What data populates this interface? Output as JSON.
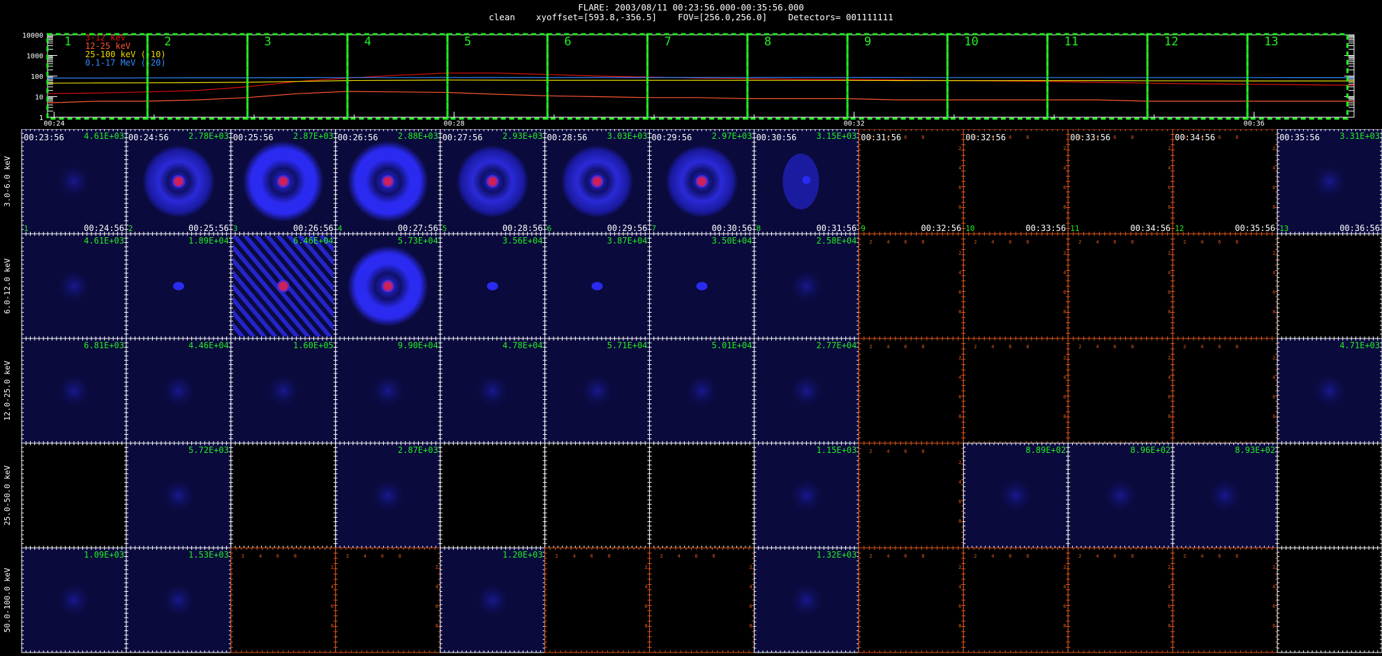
{
  "header": {
    "line1": "FLARE: 2003/08/11 00:23:56.000-00:35:56.000",
    "line2": "clean    xyoffset=[593.8,-356.5]    FOV=[256.0,256.0]    Detectors= 001111111"
  },
  "colors": {
    "background": "#000000",
    "frame": "#ffffff",
    "green_label": "#22ee22",
    "empty_axis": "#e0581c",
    "image_bg": "#0a0a3c",
    "image_blue": "#2a2af0",
    "core_red": "#d0205a",
    "series_3_12": "#e01010",
    "series_12_25": "#ff5533",
    "series_25_100": "#eedd00",
    "series_0p1_17": "#3388ff"
  },
  "chart_data": [
    {
      "type": "line",
      "yscale": "log",
      "ylim": [
        1,
        10000
      ],
      "ytick_labels": [
        "10000",
        "1000",
        "100",
        "10",
        "1"
      ],
      "xlim": [
        "00:23:56",
        "00:37:00"
      ],
      "xtick_labels": [
        "00:24",
        "00:28",
        "00:32",
        "00:36"
      ],
      "x_minutes": [
        0,
        0.5,
        1,
        1.5,
        2,
        2.5,
        3,
        3.5,
        4,
        4.5,
        5,
        5.5,
        6,
        6.5,
        7,
        7.5,
        8,
        8.5,
        9,
        9.5,
        10,
        10.5,
        11,
        11.5,
        12,
        12.5,
        13,
        13.5,
        14,
        14.2,
        14.4,
        14.6,
        14.8,
        15
      ],
      "series": [
        {
          "name": "3-12 keV",
          "color": "#e01010",
          "values": [
            14,
            15,
            17,
            20,
            30,
            55,
            80,
            110,
            140,
            140,
            120,
            100,
            90,
            80,
            75,
            70,
            68,
            65,
            60,
            58,
            55,
            50,
            45,
            42,
            40,
            38,
            36,
            33,
            30,
            22,
            14,
            18,
            24,
            25
          ]
        },
        {
          "name": "12-25 keV",
          "color": "#ff5533",
          "values": [
            5,
            6,
            6,
            7,
            9,
            14,
            18,
            17,
            16,
            13,
            11,
            10,
            9,
            9,
            8,
            8,
            8,
            7,
            7,
            7,
            7,
            7,
            6,
            6,
            6,
            6,
            6,
            6,
            6,
            5,
            4,
            5,
            6,
            6
          ]
        },
        {
          "name": "25-100 keV (-10)",
          "color": "#eedd00",
          "values": [
            45,
            46,
            47,
            48,
            50,
            55,
            60,
            62,
            64,
            63,
            62,
            62,
            62,
            62,
            62,
            61,
            61,
            60,
            60,
            60,
            60,
            60,
            59,
            59,
            58,
            58,
            58,
            58,
            57,
            30,
            2,
            20,
            55,
            57
          ]
        },
        {
          "name": "0.1-17 MeV (-20)",
          "color": "#3388ff",
          "values": [
            80,
            80,
            81,
            82,
            82,
            83,
            84,
            84,
            85,
            85,
            85,
            85,
            85,
            85,
            85,
            85,
            85,
            85,
            84,
            84,
            84,
            84,
            84,
            84,
            84,
            83,
            83,
            83,
            82,
            40,
            1.5,
            30,
            80,
            82
          ]
        }
      ],
      "intervals": [
        {
          "label": "1",
          "start": "00:23:56",
          "end": "00:24:56"
        },
        {
          "label": "2",
          "start": "00:24:56",
          "end": "00:25:56"
        },
        {
          "label": "3",
          "start": "00:25:56",
          "end": "00:26:56"
        },
        {
          "label": "4",
          "start": "00:26:56",
          "end": "00:27:56"
        },
        {
          "label": "5",
          "start": "00:27:56",
          "end": "00:28:56"
        },
        {
          "label": "6",
          "start": "00:28:56",
          "end": "00:29:56"
        },
        {
          "label": "7",
          "start": "00:29:56",
          "end": "00:30:56"
        },
        {
          "label": "8",
          "start": "00:30:56",
          "end": "00:31:56"
        },
        {
          "label": "9",
          "start": "00:31:56",
          "end": "00:32:56"
        },
        {
          "label": "10",
          "start": "00:32:56",
          "end": "00:33:56"
        },
        {
          "label": "11",
          "start": "00:33:56",
          "end": "00:34:56"
        },
        {
          "label": "12",
          "start": "00:34:56",
          "end": "00:35:56"
        },
        {
          "label": "13",
          "start": "00:35:56",
          "end": "00:36:56"
        }
      ]
    },
    {
      "type": "heatmap",
      "energy_bands": [
        "3.0-6.0 keV",
        "6.0-12.0 keV",
        "12.0-25.0 keV",
        "25.0-50.0 keV",
        "50.0-100.0 keV"
      ],
      "interval_numbers": [
        "1",
        "2",
        "3",
        "4",
        "5",
        "6",
        "7",
        "8",
        "9",
        "10",
        "11",
        "12",
        "13"
      ],
      "start_times": [
        "00:23:56",
        "00:24:56",
        "00:25:56",
        "00:26:56",
        "00:27:56",
        "00:28:56",
        "00:29:56",
        "00:30:56",
        "00:31:56",
        "00:32:56",
        "00:33:56",
        "00:34:56",
        "00:35:56"
      ],
      "end_times": [
        "00:24:56",
        "00:25:56",
        "00:26:56",
        "00:27:56",
        "00:28:56",
        "00:29:56",
        "00:30:56",
        "00:31:56",
        "00:32:56",
        "00:33:56",
        "00:34:56",
        "00:35:56",
        "00:36:56"
      ],
      "empty_axis_tick_labels": [
        "2",
        "4",
        "6",
        "8"
      ],
      "peak_values": [
        [
          "4.61E+03",
          "2.78E+03",
          "2.87E+03",
          "2.88E+03",
          "2.93E+03",
          "3.03E+03",
          "2.97E+03",
          "3.15E+03",
          null,
          null,
          null,
          null,
          "3.31E+03"
        ],
        [
          "4.61E+03",
          "1.89E+04",
          "6.46E+04",
          "5.73E+04",
          "3.56E+04",
          "3.87E+04",
          "3.50E+04",
          "2.58E+04",
          null,
          null,
          null,
          null,
          null
        ],
        [
          "6.81E+03",
          "4.46E+04",
          "1.60E+05",
          "9.90E+04",
          "4.78E+04",
          "5.71E+04",
          "5.01E+04",
          "2.77E+04",
          null,
          null,
          null,
          null,
          "4.71E+03"
        ],
        [
          null,
          "5.72E+03",
          null,
          "2.87E+03",
          null,
          null,
          null,
          "1.15E+03",
          null,
          "8.89E+02",
          "8.96E+02",
          "8.93E+02",
          null
        ],
        [
          "1.09E+03",
          "1.53E+03",
          null,
          null,
          "1.20E+03",
          null,
          null,
          "1.32E+03",
          null,
          null,
          null,
          null,
          null
        ]
      ],
      "cell_kind": [
        [
          "faint",
          "ring",
          "ring",
          "ring",
          "ring",
          "ring",
          "ring",
          "blob",
          "empty",
          "empty",
          "empty",
          "empty",
          "faint"
        ],
        [
          "faint",
          "dot",
          "stripes",
          "ring",
          "dot",
          "dot",
          "dot",
          "faint",
          "empty",
          "empty",
          "empty",
          "empty",
          "black"
        ],
        [
          "faint",
          "faint",
          "faint",
          "faint",
          "faint",
          "faint",
          "faint",
          "faint",
          "empty",
          "empty",
          "empty",
          "empty",
          "faint"
        ],
        [
          "black",
          "faint",
          "black",
          "faint",
          "black",
          "black",
          "black",
          "faint",
          "empty",
          "faint",
          "faint",
          "faint",
          "black"
        ],
        [
          "faint",
          "faint",
          "empty",
          "empty",
          "faint",
          "empty",
          "empty",
          "faint",
          "empty",
          "empty",
          "empty",
          "empty",
          "black"
        ]
      ]
    }
  ]
}
